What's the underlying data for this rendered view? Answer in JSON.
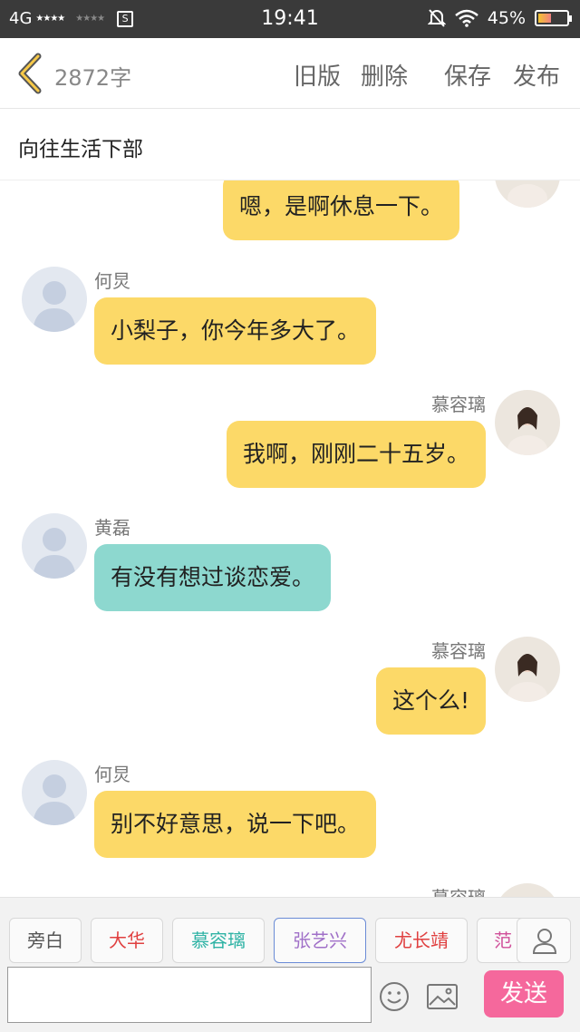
{
  "status_bar": {
    "network": "4G",
    "signal_stars": "★★★★",
    "signal_stars_2": "★★★★",
    "sim_icon": "S",
    "time": "19:41",
    "battery": "45%",
    "battery_level": 0.45
  },
  "header": {
    "word_count": "2872字",
    "old_version": "旧版",
    "delete": "删除",
    "save": "保存",
    "publish": "发布"
  },
  "doc_title": "向往生活下部",
  "messages": [
    {
      "side": "right",
      "name": "",
      "text": "嗯，是啊休息一下。",
      "color": "#fcd968"
    },
    {
      "side": "left",
      "name": "何炅",
      "text": "小梨子，你今年多大了。",
      "color": "#fcd968"
    },
    {
      "side": "right",
      "name": "慕容璃",
      "text": "我啊，刚刚二十五岁。",
      "color": "#fcd968"
    },
    {
      "side": "left",
      "name": "黄磊",
      "text": "有没有想过谈恋爱。",
      "color": "#8dd8cf"
    },
    {
      "side": "right",
      "name": "慕容璃",
      "text": "这个么!",
      "color": "#fcd968"
    },
    {
      "side": "left",
      "name": "何炅",
      "text": "别不好意思，说一下吧。",
      "color": "#fcd968"
    },
    {
      "side": "right",
      "name": "慕容璃",
      "text": "",
      "color": "#fcd968"
    }
  ],
  "characters": [
    {
      "label": "旁白",
      "color": "#555555"
    },
    {
      "label": "大华",
      "color": "#e04040"
    },
    {
      "label": "慕容璃",
      "color": "#2fb3a5"
    },
    {
      "label": "张艺兴",
      "color": "#a070c8"
    },
    {
      "label": "尤长靖",
      "color": "#e04040"
    },
    {
      "label": "范",
      "color": "#d0509a"
    }
  ],
  "composer": {
    "placeholder": "",
    "send": "发送"
  },
  "icons": {
    "back": "chevron-left-icon",
    "user": "user-icon",
    "emoji": "smiley-icon",
    "image": "image-icon"
  }
}
